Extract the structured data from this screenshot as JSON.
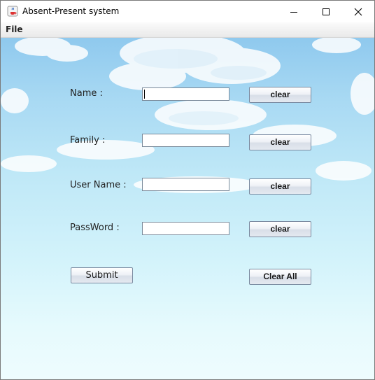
{
  "window": {
    "title": "Absent-Present system"
  },
  "menu": {
    "file": "File"
  },
  "form": {
    "fields": [
      {
        "label": "Name :",
        "value": "",
        "clear": "clear"
      },
      {
        "label": "Family :",
        "value": "",
        "clear": "clear"
      },
      {
        "label": "User Name :",
        "value": "",
        "clear": "clear"
      },
      {
        "label": "PassWord :",
        "value": "",
        "clear": "clear"
      }
    ],
    "submit": "Submit",
    "clear_all": "Clear All"
  },
  "icons": {
    "app": "java-cup-icon",
    "minimize": "minimize-icon",
    "maximize": "maximize-icon",
    "close": "close-icon"
  }
}
